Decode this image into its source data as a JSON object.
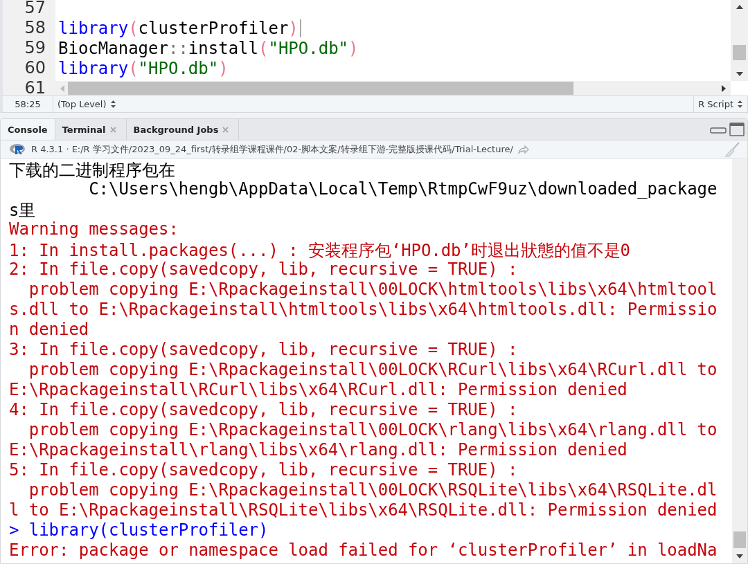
{
  "editor": {
    "lines": [
      {
        "number": "57"
      },
      {
        "number": "58",
        "tokens": [
          {
            "kind": "function",
            "text": "library"
          },
          {
            "kind": "paren",
            "text": "("
          },
          {
            "kind": "plain",
            "text": "clusterProfiler"
          },
          {
            "kind": "paren",
            "text": ")"
          }
        ],
        "cursor": true
      },
      {
        "number": "59",
        "tokens": [
          {
            "kind": "plain",
            "text": "BiocManager"
          },
          {
            "kind": "operator",
            "text": "::"
          },
          {
            "kind": "plain",
            "text": "install"
          },
          {
            "kind": "paren",
            "text": "("
          },
          {
            "kind": "string",
            "text": "\"HPO.db\""
          },
          {
            "kind": "paren",
            "text": ")"
          }
        ]
      },
      {
        "number": "60",
        "tokens": [
          {
            "kind": "function",
            "text": "library"
          },
          {
            "kind": "paren",
            "text": "("
          },
          {
            "kind": "string",
            "text": "\"HPO.db\""
          },
          {
            "kind": "paren",
            "text": ")"
          }
        ]
      },
      {
        "number": "61"
      }
    ],
    "cursor_position": "58:25",
    "scope": "(Top Level)",
    "file_type": "R Script"
  },
  "console": {
    "tabs": [
      {
        "label": "Console",
        "selected": true,
        "closable": false
      },
      {
        "label": "Terminal",
        "selected": false,
        "closable": true
      },
      {
        "label": "Background Jobs",
        "selected": false,
        "closable": true
      }
    ],
    "path": "R 4.3.1 · E:/R 学习文件/2023_09_24_first/转录组学课程课件/02-脚本文案/转录组下游-完整版授课代码/Trial-Lecture/",
    "lines": [
      {
        "kind": "output",
        "text": "下载的二进制程序包在"
      },
      {
        "kind": "output",
        "text": "        C:\\Users\\hengb\\AppData\\Local\\Temp\\RtmpCwF9uz\\downloaded_package"
      },
      {
        "kind": "output",
        "text": "s里"
      },
      {
        "kind": "error",
        "text": "Warning messages:"
      },
      {
        "kind": "error",
        "text": "1: In install.packages(...) : 安装程序包‘HPO.db’时退出狀態的值不是0"
      },
      {
        "kind": "error",
        "text": "2: In file.copy(savedcopy, lib, recursive = TRUE) :"
      },
      {
        "kind": "error",
        "text": "  problem copying E:\\Rpackageinstall\\00LOCK\\htmltools\\libs\\x64\\htmltool"
      },
      {
        "kind": "error",
        "text": "s.dll to E:\\Rpackageinstall\\htmltools\\libs\\x64\\htmltools.dll: Permissio"
      },
      {
        "kind": "error",
        "text": "n denied"
      },
      {
        "kind": "error",
        "text": "3: In file.copy(savedcopy, lib, recursive = TRUE) :"
      },
      {
        "kind": "error",
        "text": "  problem copying E:\\Rpackageinstall\\00LOCK\\RCurl\\libs\\x64\\RCurl.dll to"
      },
      {
        "kind": "error",
        "text": "E:\\Rpackageinstall\\RCurl\\libs\\x64\\RCurl.dll: Permission denied"
      },
      {
        "kind": "error",
        "text": "4: In file.copy(savedcopy, lib, recursive = TRUE) :"
      },
      {
        "kind": "error",
        "text": "  problem copying E:\\Rpackageinstall\\00LOCK\\rlang\\libs\\x64\\rlang.dll to"
      },
      {
        "kind": "error",
        "text": "E:\\Rpackageinstall\\rlang\\libs\\x64\\rlang.dll: Permission denied"
      },
      {
        "kind": "error",
        "text": "5: In file.copy(savedcopy, lib, recursive = TRUE) :"
      },
      {
        "kind": "error",
        "text": "  problem copying E:\\Rpackageinstall\\00LOCK\\RSQLite\\libs\\x64\\RSQLite.dl"
      },
      {
        "kind": "error",
        "text": "l to E:\\Rpackageinstall\\RSQLite\\libs\\x64\\RSQLite.dll: Permission denied"
      },
      {
        "kind": "input",
        "text": "> library(clusterProfiler)"
      },
      {
        "kind": "error",
        "text": "Error: package or namespace load failed for ‘clusterProfiler’ in loadNa"
      }
    ]
  }
}
